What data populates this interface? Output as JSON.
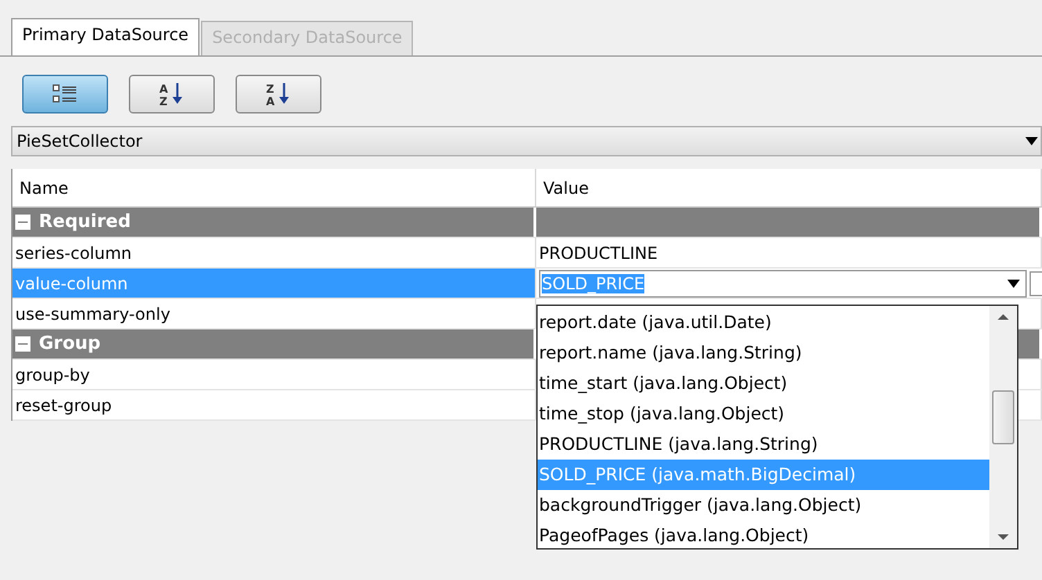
{
  "tabs": [
    {
      "label": "Primary DataSource",
      "selected": true,
      "disabled": false
    },
    {
      "label": "Secondary DataSource",
      "selected": false,
      "disabled": true
    }
  ],
  "toolbar": [
    {
      "kind": "categorized",
      "selected": true
    },
    {
      "kind": "sort",
      "letters": [
        "A",
        "Z"
      ],
      "selected": false
    },
    {
      "kind": "sort",
      "letters": [
        "Z",
        "A"
      ],
      "selected": false
    }
  ],
  "collector": {
    "value": "PieSetCollector"
  },
  "table": {
    "columns": [
      "Name",
      "Value"
    ],
    "groups": [
      {
        "title": "Required",
        "expanded": true,
        "rows": [
          {
            "name": "series-column",
            "value": "PRODUCTLINE",
            "selected": false
          },
          {
            "name": "value-column",
            "value": "SOLD_PRICE",
            "selected": true,
            "editing": true
          },
          {
            "name": "use-summary-only",
            "selected": false
          }
        ]
      },
      {
        "title": "Group",
        "expanded": true,
        "rows": [
          {
            "name": "group-by",
            "selected": false
          },
          {
            "name": "reset-group",
            "selected": false
          }
        ]
      }
    ]
  },
  "dropdown": {
    "items": [
      {
        "label": "report.date (java.util.Date)",
        "selected": false
      },
      {
        "label": "report.name (java.lang.String)",
        "selected": false
      },
      {
        "label": "time_start (java.lang.Object)",
        "selected": false
      },
      {
        "label": "time_stop (java.lang.Object)",
        "selected": false
      },
      {
        "label": "PRODUCTLINE (java.lang.String)",
        "selected": false
      },
      {
        "label": "SOLD_PRICE (java.math.BigDecimal)",
        "selected": true
      },
      {
        "label": "backgroundTrigger (java.lang.Object)",
        "selected": false
      },
      {
        "label": "PageofPages (java.lang.Object)",
        "selected": false
      }
    ]
  }
}
